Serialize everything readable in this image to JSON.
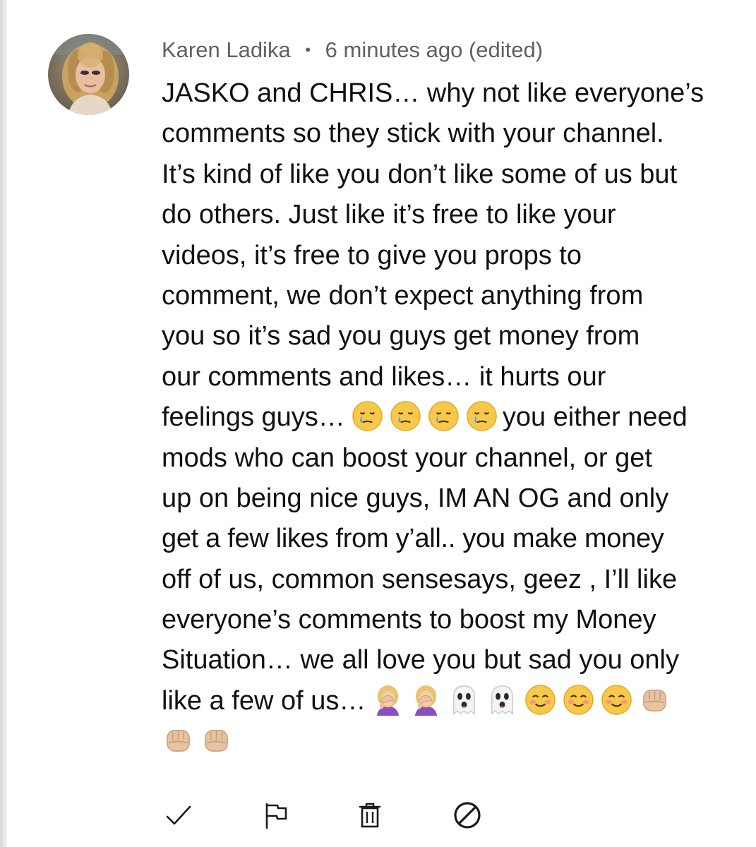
{
  "comment": {
    "author": "Karen Ladika",
    "separator": "•",
    "timestamp": "6 minutes ago (edited)",
    "lines": [
      "JASKO and CHRIS… why not like everyone’s",
      "comments so they stick with your channel.",
      "It’s kind of like you don’t like some of us but",
      "do others. Just like it’s free to like your",
      "videos, it’s free to give you props to",
      "comment, we don’t expect anything from",
      "you so it’s sad you guys get money from",
      "our comments and likes… it hurts our",
      "feelings guys…",
      "you either need",
      "mods who can boost your channel, or get",
      "up on being nice guys, IM AN OG and only",
      "get a few likes from y’all.. you make money",
      "off of us, common sensesays, geez , I’ll like",
      "everyone’s comments to boost my Money",
      "Situation… we all love you but sad you only",
      "like a few of us…"
    ],
    "emojis": {
      "tears_row": [
        "crying-face",
        "crying-face",
        "crying-face",
        "crying-face"
      ],
      "end_row_1": [
        "facepalm",
        "facepalm",
        "ghost",
        "ghost",
        "smiling-blush",
        "smiling-blush",
        "smiling-blush",
        "fist-bump"
      ],
      "end_row_2": [
        "fist-bump",
        "fist-bump"
      ]
    }
  },
  "actions": [
    {
      "id": "approve",
      "icon": "check-icon"
    },
    {
      "id": "report",
      "icon": "flag-icon"
    },
    {
      "id": "delete",
      "icon": "trash-icon"
    },
    {
      "id": "block",
      "icon": "block-icon"
    }
  ],
  "colors": {
    "text": "#111111",
    "meta": "#606060",
    "icon": "#1a1a1a"
  }
}
